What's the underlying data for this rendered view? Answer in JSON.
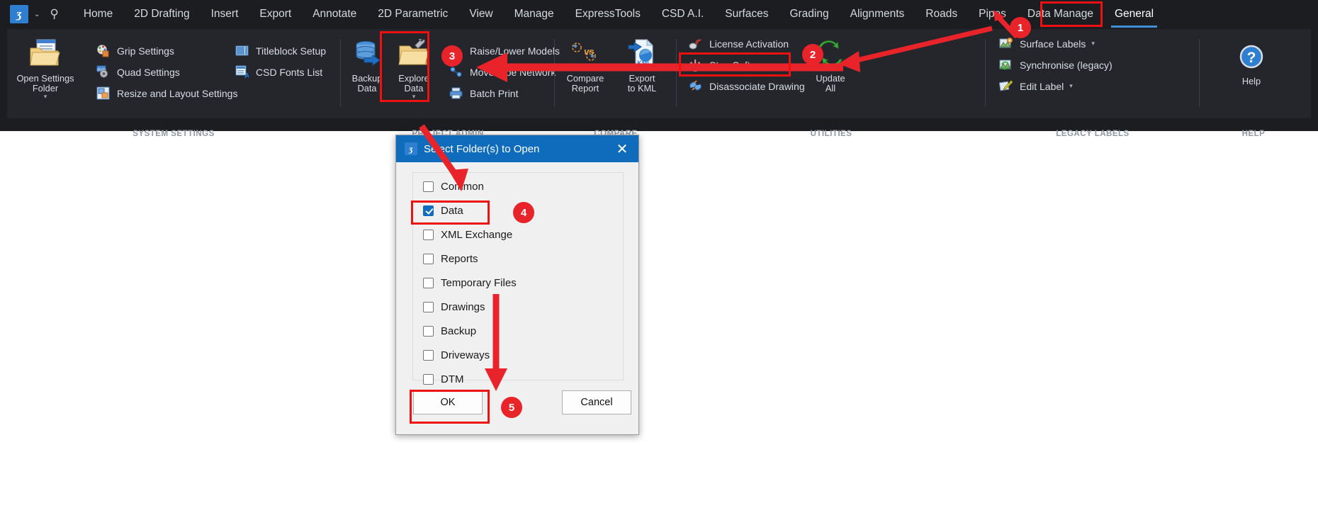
{
  "app": {
    "logo_glyph": "ʒ",
    "quick_caret": "⌄",
    "search_icon": "⚲"
  },
  "tabs": [
    {
      "label": "Home",
      "active": false
    },
    {
      "label": "2D Drafting",
      "active": false
    },
    {
      "label": "Insert",
      "active": false
    },
    {
      "label": "Export",
      "active": false
    },
    {
      "label": "Annotate",
      "active": false
    },
    {
      "label": "2D Parametric",
      "active": false
    },
    {
      "label": "View",
      "active": false
    },
    {
      "label": "Manage",
      "active": false
    },
    {
      "label": "ExpressTools",
      "active": false
    },
    {
      "label": "CSD A.I.",
      "active": false
    },
    {
      "label": "Surfaces",
      "active": false
    },
    {
      "label": "Grading",
      "active": false
    },
    {
      "label": "Alignments",
      "active": false
    },
    {
      "label": "Roads",
      "active": false
    },
    {
      "label": "Pipes",
      "active": false
    },
    {
      "label": "Data Manage",
      "active": false
    },
    {
      "label": "General",
      "active": true
    }
  ],
  "panels": [
    {
      "title": "SYSTEM SETTINGS",
      "big": [
        {
          "label_line1": "Open Settings",
          "label_line2": "Folder",
          "has_dropdown": true
        }
      ],
      "items": [
        {
          "label": "Grip Settings"
        },
        {
          "label": "Quad Settings"
        },
        {
          "label": "Resize and Layout Settings"
        },
        {
          "label": "Titleblock Setup"
        },
        {
          "label": "CSD Fonts List"
        }
      ]
    },
    {
      "title": "PROJECT ADMIN",
      "big": [
        {
          "label_line1": "Backup",
          "label_line2": "Data",
          "has_dropdown": false
        },
        {
          "label_line1": "Explore",
          "label_line2": "Data",
          "has_dropdown": true
        }
      ],
      "items": [
        {
          "label": "Raise/Lower Models"
        },
        {
          "label": "Move Pipe Network"
        },
        {
          "label": "Batch Print"
        }
      ]
    },
    {
      "title": "COMPARE",
      "big": [
        {
          "label_line1": "Compare",
          "label_line2": "Report",
          "has_dropdown": false
        },
        {
          "label_line1": "Export",
          "label_line2": "to KML",
          "has_dropdown": false
        }
      ],
      "items": []
    },
    {
      "title": "UTILITIES",
      "big": [
        {
          "label_line1": "Update",
          "label_line2": "All",
          "has_dropdown": false
        }
      ],
      "items": [
        {
          "label": "License Activation"
        },
        {
          "label": "Stop Software"
        },
        {
          "label": "Disassociate Drawing"
        }
      ]
    },
    {
      "title": "LEGACY LABELS",
      "big": [],
      "items": [
        {
          "label": "Surface Labels",
          "caret": "▾"
        },
        {
          "label": "Synchronise (legacy)",
          "caret": ""
        },
        {
          "label": "Edit Label",
          "caret": "▾"
        }
      ]
    },
    {
      "title": "HELP",
      "big": [
        {
          "label_line1": "Help",
          "label_line2": "",
          "has_dropdown": false
        }
      ],
      "items": []
    }
  ],
  "dialog": {
    "title": "Select Folder(s) to Open",
    "logo_glyph": "ʒ",
    "close_glyph": "✕",
    "checkboxes": [
      {
        "label": "Common",
        "checked": false
      },
      {
        "label": "Data",
        "checked": true
      },
      {
        "label": "XML Exchange",
        "checked": false
      },
      {
        "label": "Reports",
        "checked": false
      },
      {
        "label": "Temporary Files",
        "checked": false
      },
      {
        "label": "Drawings",
        "checked": false
      },
      {
        "label": "Backup",
        "checked": false
      },
      {
        "label": "Driveways",
        "checked": false
      },
      {
        "label": "DTM",
        "checked": false
      }
    ],
    "ok_label": "OK",
    "cancel_label": "Cancel"
  },
  "annotations": {
    "accent_color": "#e8242a",
    "steps": [
      {
        "number": "1"
      },
      {
        "number": "2"
      },
      {
        "number": "3"
      },
      {
        "number": "4"
      },
      {
        "number": "5"
      }
    ]
  }
}
